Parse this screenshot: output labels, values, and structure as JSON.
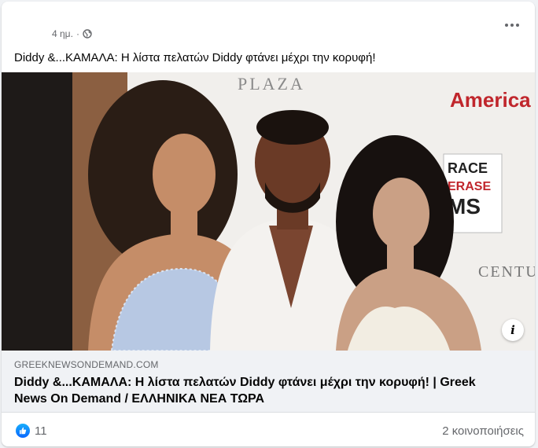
{
  "post": {
    "timestamp": "4 ημ.",
    "separator": "·",
    "audience_icon": "globe-icon",
    "menu_icon": "more-options-icon",
    "text": "Diddy &...ΚΑΜΑΛΑ: Η λίστα πελατών Diddy φτάνει μέχρι την κορυφή!"
  },
  "image": {
    "signs": {
      "hotel": "PLAZA",
      "brand": "America",
      "race1": "RACE",
      "race2": "ERASE",
      "race3": "MS",
      "center": "CENTUR"
    },
    "info_icon": "info-icon",
    "info_glyph": "i"
  },
  "link": {
    "domain": "GREEKNEWSONDEMAND.COM",
    "title": "Diddy &...ΚΑΜΑΛΑ: Η λίστα πελατών Diddy φτάνει μέχρι την κορυφή! | Greek News On Demand / ΕΛΛΗΝΙΚΑ ΝΕΑ ΤΩΡΑ"
  },
  "footer": {
    "reaction_icon": "like-icon",
    "like_count": "11",
    "shares": "2 κοινοποιήσεις"
  },
  "colors": {
    "accent": "#0866ff",
    "secondary_text": "#65676b",
    "link_bg": "#f0f2f5"
  }
}
